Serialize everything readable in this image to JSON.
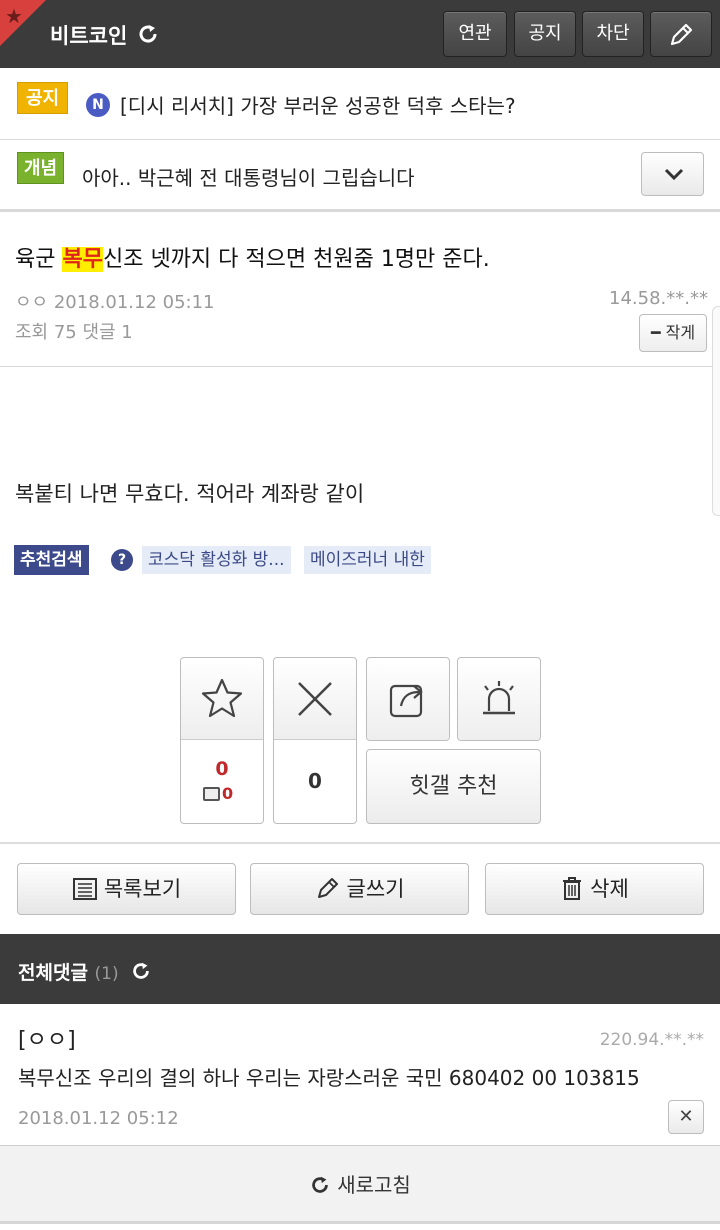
{
  "header": {
    "gallery_name": "비트코인",
    "buttons": {
      "related": "연관",
      "notice": "공지",
      "block": "차단"
    }
  },
  "notices": [
    {
      "badge": "공지",
      "badge_color": "#f0b400",
      "marker": "N",
      "text": "[디시 리서치] 가장 부러운 성공한 덕후 스타는?"
    },
    {
      "badge": "개념",
      "badge_color": "#7ab22e",
      "text": "아아.. 박근혜 전 대통령님이 그립습니다"
    }
  ],
  "post": {
    "title_before": "육군 ",
    "title_highlight": "복무",
    "title_after": "신조 넷까지 다 적으면 천원줌 1명만 준다.",
    "meta": "ㅇㅇ 2018.01.12 05:11",
    "ip": "14.58.**.**",
    "stats": "조회 75 댓글 1",
    "font_button": "━ 작게",
    "body": "복붙티 나면 무효다. 적어라 계좌랑 같이"
  },
  "recommend_search": {
    "label": "추천검색",
    "help": "?",
    "tags": [
      "코스닥 활성화 방...",
      "메이즈러너 내한"
    ]
  },
  "actions": {
    "recommend_count": "0",
    "fix_count": "0",
    "nonrecommend_count": "0",
    "hit_button": "힛갤 추천"
  },
  "bottom_buttons": {
    "list": "목록보기",
    "write": "글쓰기",
    "delete": "삭제"
  },
  "comments": {
    "title": "전체댓글",
    "count": "(1)",
    "items": [
      {
        "author": "[ㅇㅇ]",
        "ip": "220.94.**.**",
        "text": "복무신조 우리의 결의 하나 우리는 자랑스러운 국민 680402 00 103815",
        "date": "2018.01.12 05:12",
        "delete": "✕"
      }
    ]
  },
  "refresh": "새로고침",
  "colors": {
    "header_bg": "#3b3b3b",
    "highlight": "#ffee00",
    "highlight_text": "#e0241b",
    "accent": "#3c4a8c"
  }
}
